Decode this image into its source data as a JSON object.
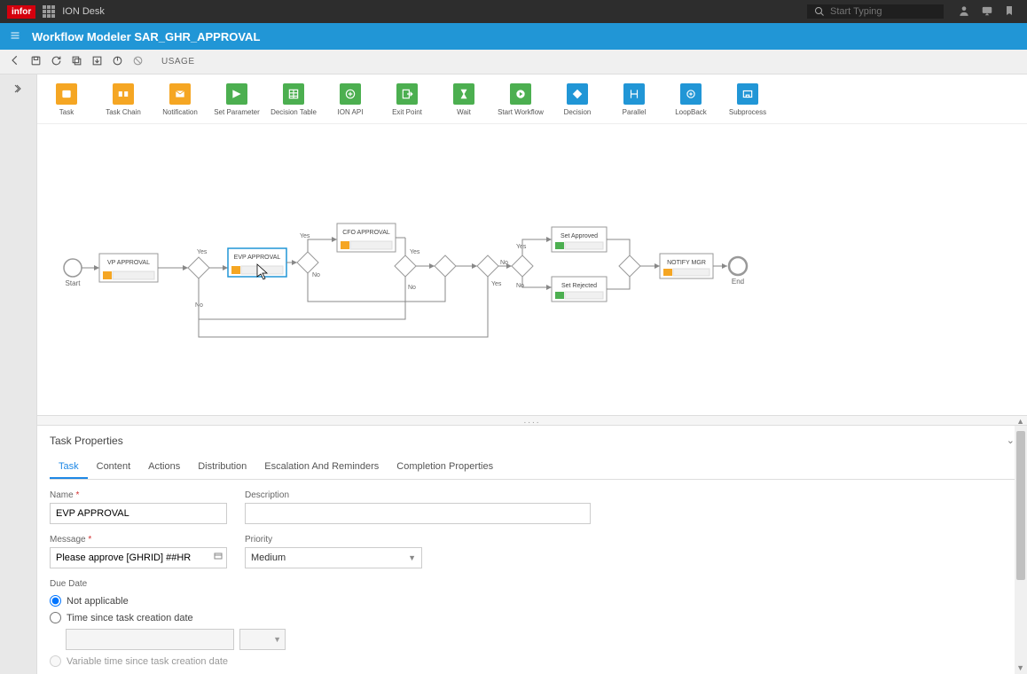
{
  "header": {
    "logo": "infor",
    "app": "ION Desk",
    "search_placeholder": "Start Typing"
  },
  "titlebar": {
    "title": "Workflow Modeler SAR_GHR_APPROVAL"
  },
  "toolbar": {
    "usage": "USAGE"
  },
  "palette": [
    {
      "label": "Task",
      "color": "orange"
    },
    {
      "label": "Task Chain",
      "color": "orange"
    },
    {
      "label": "Notification",
      "color": "orange"
    },
    {
      "label": "Set Parameter",
      "color": "green"
    },
    {
      "label": "Decision Table",
      "color": "green"
    },
    {
      "label": "ION API",
      "color": "green"
    },
    {
      "label": "Exit Point",
      "color": "green"
    },
    {
      "label": "Wait",
      "color": "green"
    },
    {
      "label": "Start Workflow",
      "color": "green"
    },
    {
      "label": "Decision",
      "color": "blue"
    },
    {
      "label": "Parallel",
      "color": "blue"
    },
    {
      "label": "LoopBack",
      "color": "blue"
    },
    {
      "label": "Subprocess",
      "color": "blue"
    }
  ],
  "diagram": {
    "start_label": "Start",
    "end_label": "End",
    "nodes": {
      "vp": "VP APPROVAL",
      "evp": "EVP APPROVAL",
      "cfo": "CFO APPROVAL",
      "set_approved": "Set Approved",
      "set_rejected": "Set Rejected",
      "notify_mgr": "NOTIFY MGR"
    },
    "edge_labels": {
      "yes": "Yes",
      "no": "No"
    }
  },
  "props": {
    "title": "Task Properties",
    "tabs": [
      "Task",
      "Content",
      "Actions",
      "Distribution",
      "Escalation And Reminders",
      "Completion Properties"
    ],
    "active_tab": 0,
    "fields": {
      "name_label": "Name",
      "name_value": "EVP APPROVAL",
      "description_label": "Description",
      "description_value": "",
      "message_label": "Message",
      "message_value": "Please approve [GHRID] ##HR",
      "priority_label": "Priority",
      "priority_value": "Medium",
      "duedate_label": "Due Date",
      "duedate_options": {
        "na": "Not applicable",
        "since_creation": "Time since task creation date",
        "variable": "Variable time since task creation date"
      },
      "duedate_selected": "na"
    }
  }
}
